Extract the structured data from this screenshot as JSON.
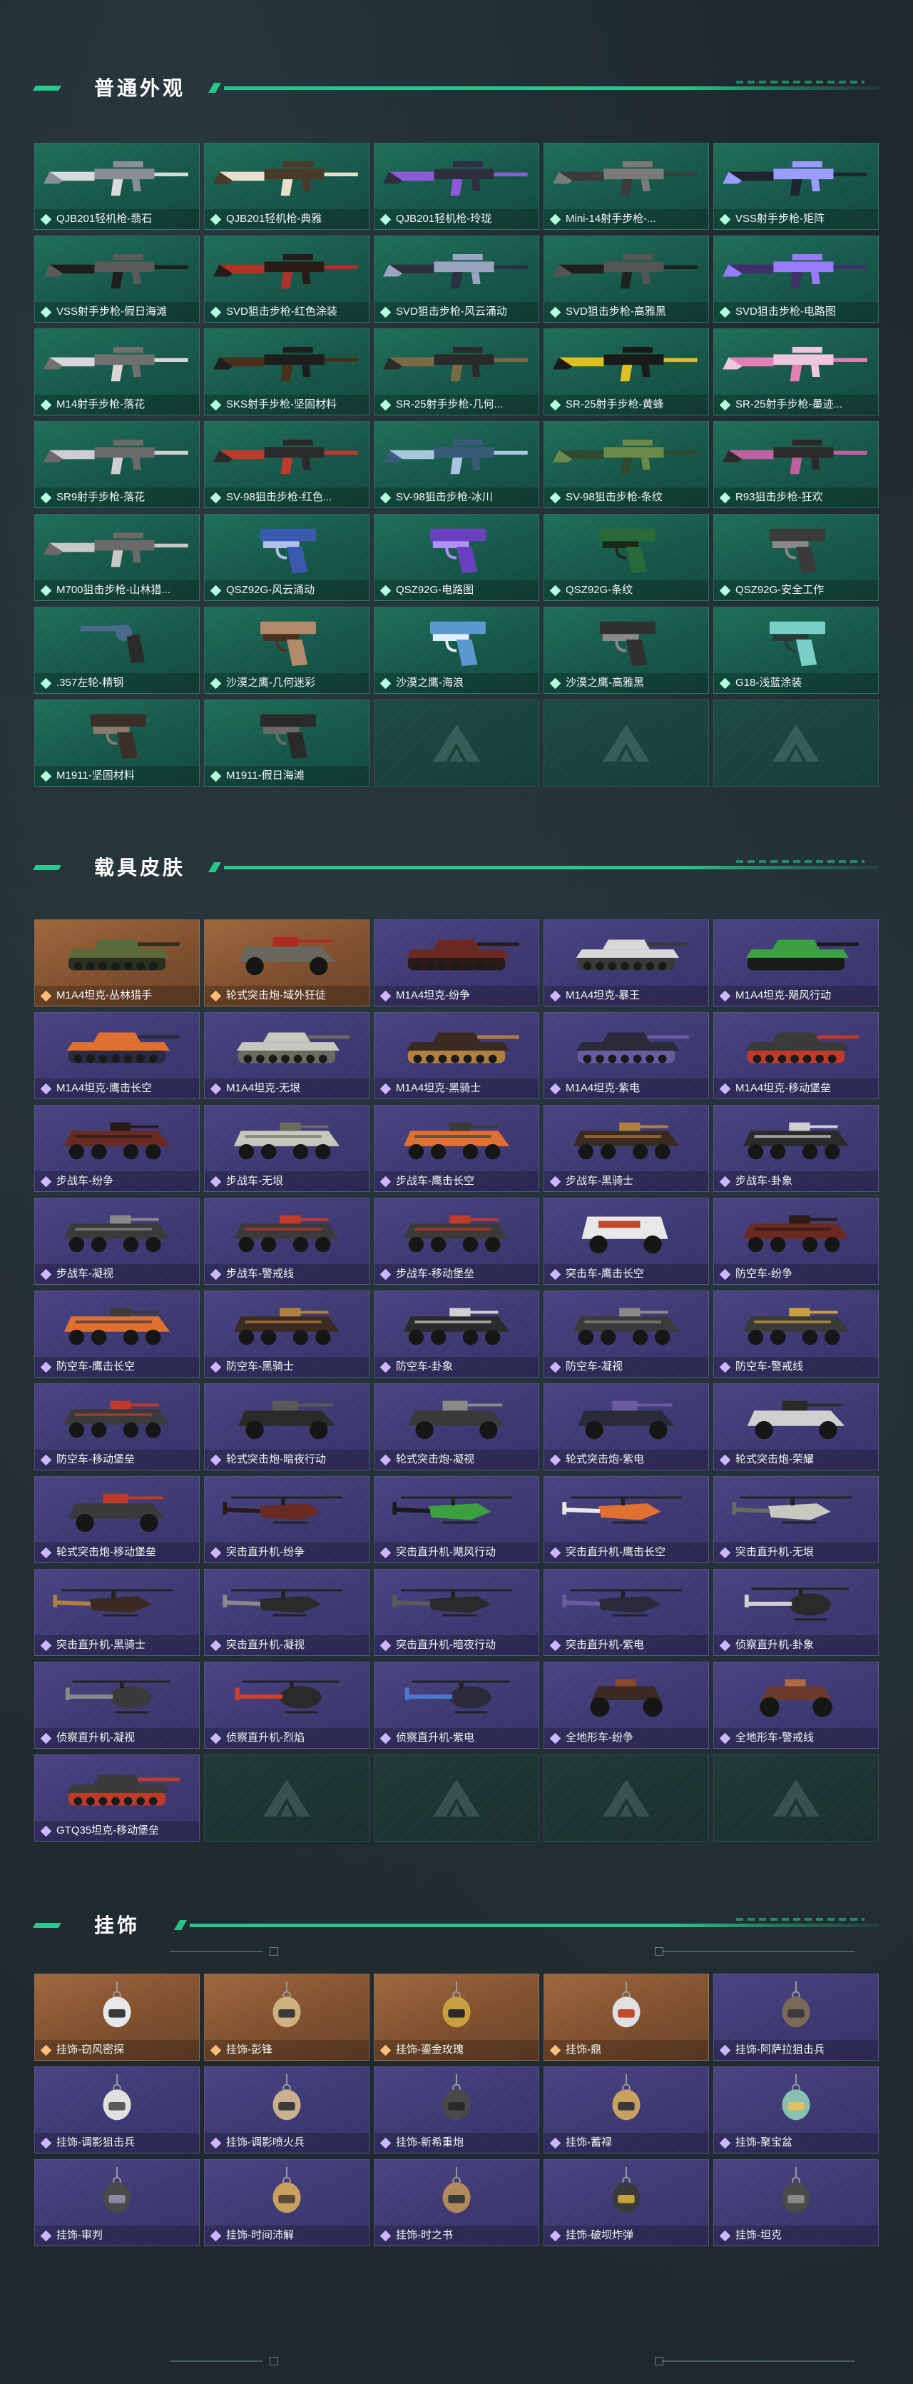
{
  "sections": {
    "weapons": {
      "title": "普通外观",
      "items": [
        {
          "label": "QJB201轻机枪-翡石",
          "art": "rifle",
          "colors": [
            "#d9dadb",
            "#8a8f96"
          ]
        },
        {
          "label": "QJB201轻机枪-典雅",
          "art": "rifle",
          "colors": [
            "#e8dfcf",
            "#4a3a2a"
          ]
        },
        {
          "label": "QJB201轻机枪-玲珑",
          "art": "rifle",
          "colors": [
            "#8c5cd8",
            "#2e2e40"
          ]
        },
        {
          "label": "Mini-14射手步枪-...",
          "art": "rifle",
          "colors": [
            "#3a3a3a",
            "#7a7a7a"
          ]
        },
        {
          "label": "VSS射手步枪-矩阵",
          "art": "rifle",
          "colors": [
            "#1e2430",
            "#9a9cff"
          ]
        },
        {
          "label": "VSS射手步枪-假日海滩",
          "art": "rifle",
          "colors": [
            "#1e1e1e",
            "#5a5a5a"
          ]
        },
        {
          "label": "SVD狙击步枪-红色涂装",
          "art": "rifle",
          "colors": [
            "#b0332a",
            "#2a1a18"
          ]
        },
        {
          "label": "SVD狙击步枪-风云涌动",
          "art": "rifle",
          "colors": [
            "#2a3040",
            "#9aa4c0"
          ]
        },
        {
          "label": "SVD狙击步枪-高雅黑",
          "art": "rifle",
          "colors": [
            "#202020",
            "#555555"
          ]
        },
        {
          "label": "SVD狙击步枪-电路图",
          "art": "rifle",
          "colors": [
            "#40306a",
            "#9a7aff"
          ]
        },
        {
          "label": "M14射手步枪-落花",
          "art": "rifle",
          "colors": [
            "#d9d6da",
            "#707070"
          ]
        },
        {
          "label": "SKS射手步枪-坚固材料",
          "art": "rifle",
          "colors": [
            "#4a2f1c",
            "#1e1e1e"
          ]
        },
        {
          "label": "SR-25射手步枪-几何...",
          "art": "rifle",
          "colors": [
            "#7a6b45",
            "#2a2a2a"
          ]
        },
        {
          "label": "SR-25射手步枪-黄蜂",
          "art": "rifle",
          "colors": [
            "#e0c020",
            "#1a1a1a"
          ]
        },
        {
          "label": "SR-25射手步枪-墨迹...",
          "art": "rifle",
          "colors": [
            "#e47fb5",
            "#f0c6de"
          ]
        },
        {
          "label": "SR9射手步枪-落花",
          "art": "rifle",
          "colors": [
            "#d0ced2",
            "#6a6a6a"
          ]
        },
        {
          "label": "SV-98狙击步枪-红色...",
          "art": "rifle",
          "colors": [
            "#c03a2c",
            "#2a2a2a"
          ]
        },
        {
          "label": "SV-98狙击步枪-冰川",
          "art": "rifle",
          "colors": [
            "#a8c6de",
            "#3a5a7a"
          ]
        },
        {
          "label": "SV-98狙击步枪-条纹",
          "art": "rifle",
          "colors": [
            "#2f4a2e",
            "#6a8a4a"
          ]
        },
        {
          "label": "R93狙击步枪-狂欢",
          "art": "rifle",
          "colors": [
            "#c060a0",
            "#2a2a2a"
          ]
        },
        {
          "label": "M700狙击步枪-山林猎...",
          "art": "rifle",
          "colors": [
            "#c8c8c8",
            "#6a6a6a"
          ]
        },
        {
          "label": "QSZ92G-风云涌动",
          "art": "pistol",
          "colors": [
            "#3a5ab0",
            "#b0c0e8"
          ]
        },
        {
          "label": "QSZ92G-电路图",
          "art": "pistol",
          "colors": [
            "#6a40c0",
            "#b090ff"
          ]
        },
        {
          "label": "QSZ92G-条纹",
          "art": "pistol",
          "colors": [
            "#2a6a3a",
            "#1a2a1a"
          ]
        },
        {
          "label": "QSZ92G-安全工作",
          "art": "pistol",
          "colors": [
            "#3a3a3a",
            "#888888"
          ]
        },
        {
          "label": ".357左轮-精钢",
          "art": "revolver",
          "colors": [
            "#4a6a8a",
            "#2a2a2a"
          ]
        },
        {
          "label": "沙漠之鹰-几何迷彩",
          "art": "pistol",
          "colors": [
            "#b08a6a",
            "#4a3020"
          ]
        },
        {
          "label": "沙漠之鹰-海浪",
          "art": "pistol",
          "colors": [
            "#5a9ad0",
            "#e0f0ff"
          ]
        },
        {
          "label": "沙漠之鹰-高雅黑",
          "art": "pistol",
          "colors": [
            "#303030",
            "#8a8a8a"
          ]
        },
        {
          "label": "G18-浅蓝涂装",
          "art": "pistol",
          "colors": [
            "#7ad0c8",
            "#2a3a3a"
          ]
        },
        {
          "label": "M1911-坚固材料",
          "art": "pistol",
          "colors": [
            "#3a3028",
            "#8a7a6a"
          ]
        },
        {
          "label": "M1911-假日海滩",
          "art": "pistol",
          "colors": [
            "#2a2a2a",
            "#6a6a6a"
          ]
        }
      ],
      "empty_count": 3
    },
    "vehicles": {
      "title": "载具皮肤",
      "items": [
        {
          "label": "M1A4坦克-丛林猎手",
          "art": "tank",
          "rarity": "orange",
          "colors": [
            "#5a6a3a",
            "#2a3020"
          ]
        },
        {
          "label": "轮式突击炮-域外狂徒",
          "art": "apc4",
          "rarity": "orange",
          "colors": [
            "#6a6660",
            "#b02a20"
          ]
        },
        {
          "label": "M1A4坦克-纷争",
          "art": "tank",
          "rarity": "purple",
          "colors": [
            "#6a2a22",
            "#2a1a18"
          ]
        },
        {
          "label": "M1A4坦克-暴王",
          "art": "tank",
          "rarity": "purple",
          "colors": [
            "#d8d8d8",
            "#3a3a3a"
          ]
        },
        {
          "label": "M1A4坦克-飓风行动",
          "art": "tank",
          "rarity": "purple",
          "colors": [
            "#3aa040",
            "#1a1a1a"
          ]
        },
        {
          "label": "M1A4坦克-鹰击长空",
          "art": "tank",
          "rarity": "purple",
          "colors": [
            "#e07030",
            "#2a2a40"
          ]
        },
        {
          "label": "M1A4坦克-无垠",
          "art": "tank",
          "rarity": "purple",
          "colors": [
            "#c8c8c0",
            "#6a6a60"
          ]
        },
        {
          "label": "M1A4坦克-黑骑士",
          "art": "tank",
          "rarity": "purple",
          "colors": [
            "#3a2a20",
            "#b08040"
          ]
        },
        {
          "label": "M1A4坦克-紫电",
          "art": "tank",
          "rarity": "purple",
          "colors": [
            "#2a2a3a",
            "#6a5aa0"
          ]
        },
        {
          "label": "M1A4坦克-移动堡垒",
          "art": "tank",
          "rarity": "purple",
          "colors": [
            "#3a3a3a",
            "#c03a2a"
          ]
        },
        {
          "label": "步战车-纷争",
          "art": "apc8",
          "rarity": "purple",
          "colors": [
            "#6a2a22",
            "#2a1a18"
          ]
        },
        {
          "label": "步战车-无垠",
          "art": "apc8",
          "rarity": "purple",
          "colors": [
            "#c8c8c0",
            "#6a6a60"
          ]
        },
        {
          "label": "步战车-鹰击长空",
          "art": "apc8",
          "rarity": "purple",
          "colors": [
            "#e07030",
            "#3a3a3a"
          ]
        },
        {
          "label": "步战车-黑骑士",
          "art": "apc8",
          "rarity": "purple",
          "colors": [
            "#3a2a20",
            "#b08040"
          ]
        },
        {
          "label": "步战车-卦象",
          "art": "apc8",
          "rarity": "purple",
          "colors": [
            "#2a2a2a",
            "#d0d0d0"
          ]
        },
        {
          "label": "步战车-凝视",
          "art": "apc8",
          "rarity": "purple",
          "colors": [
            "#3a3a3a",
            "#8a8a8a"
          ]
        },
        {
          "label": "步战车-警戒线",
          "art": "apc8",
          "rarity": "purple",
          "colors": [
            "#3a3a3a",
            "#c03a2a"
          ]
        },
        {
          "label": "步战车-移动堡垒",
          "art": "apc8",
          "rarity": "purple",
          "colors": [
            "#3a3a3a",
            "#c03a2a"
          ]
        },
        {
          "label": "突击车-鹰击长空",
          "art": "truck",
          "rarity": "purple",
          "colors": [
            "#e8e8e8",
            "#c04a2a"
          ]
        },
        {
          "label": "防空车-纷争",
          "art": "apc8",
          "rarity": "purple",
          "colors": [
            "#6a2a22",
            "#2a1a18"
          ]
        },
        {
          "label": "防空车-鹰击长空",
          "art": "apc8",
          "rarity": "purple",
          "colors": [
            "#e07030",
            "#3a3a3a"
          ]
        },
        {
          "label": "防空车-黑骑士",
          "art": "apc8",
          "rarity": "purple",
          "colors": [
            "#3a2a20",
            "#b08040"
          ]
        },
        {
          "label": "防空车-卦象",
          "art": "apc8",
          "rarity": "purple",
          "colors": [
            "#2a2a2a",
            "#d0d0d0"
          ]
        },
        {
          "label": "防空车-凝视",
          "art": "apc8",
          "rarity": "purple",
          "colors": [
            "#3a3a3a",
            "#8a8a8a"
          ]
        },
        {
          "label": "防空车-警戒线",
          "art": "apc8",
          "rarity": "purple",
          "colors": [
            "#3a3a3a",
            "#c8a040"
          ]
        },
        {
          "label": "防空车-移动堡垒",
          "art": "apc8",
          "rarity": "purple",
          "colors": [
            "#3a3a3a",
            "#c03a2a"
          ]
        },
        {
          "label": "轮式突击炮-暗夜行动",
          "art": "apc4",
          "rarity": "purple",
          "colors": [
            "#2a2a2a",
            "#5a5a5a"
          ]
        },
        {
          "label": "轮式突击炮-凝视",
          "art": "apc4",
          "rarity": "purple",
          "colors": [
            "#3a3a3a",
            "#8a8a8a"
          ]
        },
        {
          "label": "轮式突击炮-紫电",
          "art": "apc4",
          "rarity": "purple",
          "colors": [
            "#2a2a3a",
            "#6a5aa0"
          ]
        },
        {
          "label": "轮式突击炮-荣耀",
          "art": "apc4",
          "rarity": "purple",
          "colors": [
            "#d0d0d0",
            "#2a2a2a"
          ]
        },
        {
          "label": "轮式突击炮-移动堡垒",
          "art": "apc4",
          "rarity": "purple",
          "colors": [
            "#3a3a3a",
            "#c03a2a"
          ]
        },
        {
          "label": "突击直升机-纷争",
          "art": "heli",
          "rarity": "purple",
          "colors": [
            "#6a2a22",
            "#2a1a18"
          ]
        },
        {
          "label": "突击直升机-飓风行动",
          "art": "heli",
          "rarity": "purple",
          "colors": [
            "#3aa040",
            "#1a1a1a"
          ]
        },
        {
          "label": "突击直升机-鹰击长空",
          "art": "heli",
          "rarity": "purple",
          "colors": [
            "#e07030",
            "#e8e8e8"
          ]
        },
        {
          "label": "突击直升机-无垠",
          "art": "heli",
          "rarity": "purple",
          "colors": [
            "#c8c8c0",
            "#6a6a60"
          ]
        },
        {
          "label": "突击直升机-黑骑士",
          "art": "heli",
          "rarity": "purple",
          "colors": [
            "#3a2a20",
            "#b08040"
          ]
        },
        {
          "label": "突击直升机-凝视",
          "art": "heli",
          "rarity": "purple",
          "colors": [
            "#2a2a2a",
            "#8a8a8a"
          ]
        },
        {
          "label": "突击直升机-暗夜行动",
          "art": "heli",
          "rarity": "purple",
          "colors": [
            "#2a2a2a",
            "#5a5a5a"
          ]
        },
        {
          "label": "突击直升机-紫电",
          "art": "heli",
          "rarity": "purple",
          "colors": [
            "#2a2a3a",
            "#6a5aa0"
          ]
        },
        {
          "label": "侦察直升机-卦象",
          "art": "scout",
          "rarity": "purple",
          "colors": [
            "#2a2a2a",
            "#d0d0d0"
          ]
        },
        {
          "label": "侦察直升机-凝视",
          "art": "scout",
          "rarity": "purple",
          "colors": [
            "#3a3a3a",
            "#8a8a8a"
          ]
        },
        {
          "label": "侦察直升机-烈焰",
          "art": "scout",
          "rarity": "purple",
          "colors": [
            "#2a2a2a",
            "#d0402a"
          ]
        },
        {
          "label": "侦察直升机-紫电",
          "art": "scout",
          "rarity": "purple",
          "colors": [
            "#2a2a3a",
            "#4a7ad0"
          ]
        },
        {
          "label": "全地形车-纷争",
          "art": "atv",
          "rarity": "purple",
          "colors": [
            "#3a2a20",
            "#8a4a2a"
          ]
        },
        {
          "label": "全地形车-警戒线",
          "art": "atv",
          "rarity": "purple",
          "colors": [
            "#6a3a2a",
            "#b06a40"
          ]
        },
        {
          "label": "GTQ35坦克-移动堡垒",
          "art": "tank",
          "rarity": "purple",
          "colors": [
            "#3a3a3a",
            "#c03a2a"
          ]
        }
      ],
      "empty_count": 4
    },
    "charms": {
      "title": "挂饰",
      "items": [
        {
          "label": "挂饰-窃风密探",
          "rarity": "orange",
          "colors": [
            "#e8e8e8",
            "#3a3a3a"
          ]
        },
        {
          "label": "挂饰-彭锋",
          "rarity": "orange",
          "colors": [
            "#d0b080",
            "#3a3a3a"
          ]
        },
        {
          "label": "挂饰-鎏金玫瑰",
          "rarity": "orange",
          "colors": [
            "#c8a040",
            "#2a2a2a"
          ]
        },
        {
          "label": "挂饰-鼎",
          "rarity": "orange",
          "colors": [
            "#e0e0e0",
            "#c04a2a"
          ]
        },
        {
          "label": "挂饰-阿萨拉狙击兵",
          "rarity": "purple",
          "colors": [
            "#7a6a5a",
            "#3a3a3a"
          ]
        },
        {
          "label": "挂饰-调影狙击兵",
          "rarity": "purple",
          "colors": [
            "#e0e0e0",
            "#5a5a5a"
          ]
        },
        {
          "label": "挂饰-调影喷火兵",
          "rarity": "purple",
          "colors": [
            "#c8b090",
            "#3a3a3a"
          ]
        },
        {
          "label": "挂饰-新希重炮",
          "rarity": "purple",
          "colors": [
            "#4a4a4a",
            "#2a2a2a"
          ]
        },
        {
          "label": "挂饰-蓄禄",
          "rarity": "purple",
          "colors": [
            "#c8a060",
            "#3a3a3a"
          ]
        },
        {
          "label": "挂饰-聚宝盆",
          "rarity": "purple",
          "colors": [
            "#8ac0b0",
            "#e0c060"
          ]
        },
        {
          "label": "挂饰-审判",
          "rarity": "purple",
          "colors": [
            "#4a4a4a",
            "#8a8aa0"
          ]
        },
        {
          "label": "挂饰-时间沛解",
          "rarity": "purple",
          "colors": [
            "#c8a060",
            "#5a4a3a"
          ]
        },
        {
          "label": "挂饰-时之书",
          "rarity": "purple",
          "colors": [
            "#b08a5a",
            "#3a3a3a"
          ]
        },
        {
          "label": "挂饰-破坝炸弹",
          "rarity": "purple",
          "colors": [
            "#3a3a3a",
            "#c8a040"
          ]
        },
        {
          "label": "挂饰-坦克",
          "rarity": "purple",
          "colors": [
            "#4a4a4a",
            "#8a8a8a"
          ]
        }
      ]
    }
  }
}
